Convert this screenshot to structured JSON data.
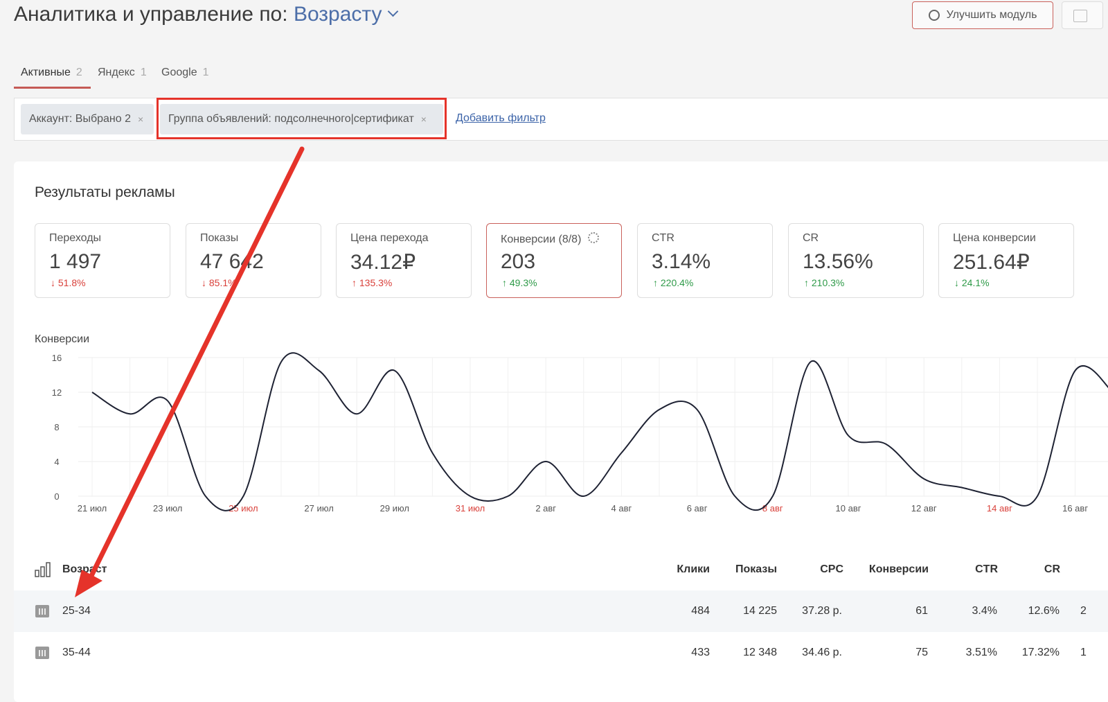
{
  "header": {
    "title_prefix": "Аналитика и управление по:",
    "dimension": "Возрасту",
    "improve_button": "Улучшить модуль"
  },
  "tabs": [
    {
      "label": "Активные",
      "count": "2",
      "active": true
    },
    {
      "label": "Яндекс",
      "count": "1",
      "active": false
    },
    {
      "label": "Google",
      "count": "1",
      "active": false
    }
  ],
  "filters": {
    "chips": [
      {
        "label": "Аккаунт: Выбрано 2",
        "close": "×"
      },
      {
        "label": "Группа объявлений: подсолнечного|сертификат",
        "close": "×"
      }
    ],
    "add_filter": "Добавить фильтр"
  },
  "results": {
    "title": "Результаты рекламы",
    "kpis": [
      {
        "label": "Переходы",
        "value": "1 497",
        "change": "↓ 51.8%",
        "direction": "down"
      },
      {
        "label": "Показы",
        "value": "47 642",
        "change": "↓ 85.1%",
        "direction": "down"
      },
      {
        "label": "Цена перехода",
        "value": "34.12₽",
        "change": "↑ 135.3%",
        "direction": "down"
      },
      {
        "label": "Конверсии (8/8)",
        "value": "203",
        "change": "↑ 49.3%",
        "direction": "up",
        "active": true
      },
      {
        "label": "CTR",
        "value": "3.14%",
        "change": "↑ 220.4%",
        "direction": "up"
      },
      {
        "label": "CR",
        "value": "13.56%",
        "change": "↑ 210.3%",
        "direction": "up"
      },
      {
        "label": "Цена конверсии",
        "value": "251.64₽",
        "change": "↓ 24.1%",
        "direction": "up"
      }
    ]
  },
  "chart_data": {
    "type": "line",
    "ylabel": "Конверсии",
    "ylim": [
      0,
      16
    ],
    "yticks": [
      "0",
      "4",
      "8",
      "12",
      "16"
    ],
    "x_tick_labels": [
      {
        "label": "21 июл",
        "weekend": false
      },
      {
        "label": "23 июл",
        "weekend": false
      },
      {
        "label": "25 июл",
        "weekend": true
      },
      {
        "label": "27 июл",
        "weekend": false
      },
      {
        "label": "29 июл",
        "weekend": false
      },
      {
        "label": "31 июл",
        "weekend": true
      },
      {
        "label": "2 авг",
        "weekend": false
      },
      {
        "label": "4 авг",
        "weekend": false
      },
      {
        "label": "6 авг",
        "weekend": false
      },
      {
        "label": "8 авг",
        "weekend": true
      },
      {
        "label": "10 авг",
        "weekend": false
      },
      {
        "label": "12 авг",
        "weekend": false
      },
      {
        "label": "14 авг",
        "weekend": true
      },
      {
        "label": "16 авг",
        "weekend": false
      }
    ],
    "x": [
      "21 июл",
      "22 июл",
      "23 июл",
      "24 июл",
      "25 июл",
      "26 июл",
      "27 июл",
      "28 июл",
      "29 июл",
      "30 июл",
      "31 июл",
      "1 авг",
      "2 авг",
      "3 авг",
      "4 авг",
      "5 авг",
      "6 авг",
      "7 авг",
      "8 авг",
      "9 авг",
      "10 авг",
      "11 авг",
      "12 авг",
      "13 авг",
      "14 авг",
      "15 авг",
      "16 авг",
      "17 авг"
    ],
    "series": [
      {
        "values": [
          12,
          9.5,
          11,
          0,
          0,
          15.5,
          14.5,
          9.5,
          14.5,
          5,
          0,
          0,
          4,
          0,
          5,
          10,
          10,
          0,
          0,
          15.5,
          7,
          6,
          2,
          1,
          0,
          0,
          14.5,
          12
        ]
      }
    ],
    "grid": true
  },
  "table": {
    "columns": [
      "Возраст",
      "Клики",
      "Показы",
      "CPC",
      "Конверсии",
      "CTR",
      "CR"
    ],
    "rows": [
      {
        "age": "25-34",
        "clicks": "484",
        "impressions": "14 225",
        "cpc": "37.28 р.",
        "conversions": "61",
        "ctr": "3.4%",
        "cr": "12.6%",
        "extra": "2"
      },
      {
        "age": "35-44",
        "clicks": "433",
        "impressions": "12 348",
        "cpc": "34.46 р.",
        "conversions": "75",
        "ctr": "3.51%",
        "cr": "17.32%",
        "extra": "1"
      }
    ]
  },
  "colors": {
    "accent": "#c55a56",
    "link": "#3b63a8",
    "annotation": "#e5332a",
    "up": "#2e9a48",
    "down": "#d9403a",
    "weekend": "#d9403a"
  }
}
